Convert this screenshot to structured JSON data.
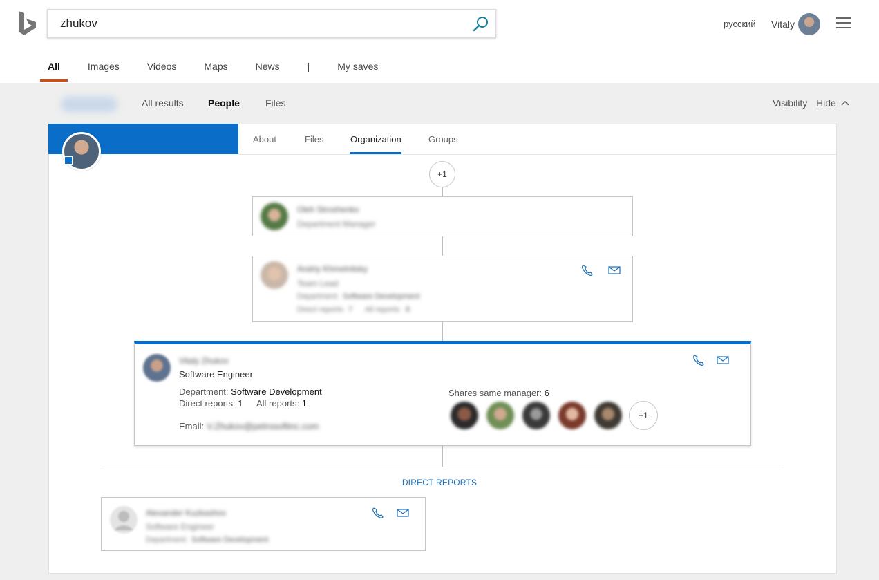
{
  "search": {
    "query": "zhukov"
  },
  "header": {
    "language": "русский",
    "user_name": "Vitaly"
  },
  "nav": {
    "items": [
      "All",
      "Images",
      "Videos",
      "Maps",
      "News",
      "|",
      "My saves"
    ],
    "active": "All"
  },
  "subnav": {
    "tabs": [
      "All results",
      "People",
      "Files"
    ],
    "active": "People",
    "visibility_label": "Visibility",
    "hide_label": "Hide"
  },
  "profile_tabs": {
    "items": [
      "About",
      "Files",
      "Organization",
      "Groups"
    ],
    "active": "Organization"
  },
  "org": {
    "more_managers_label": "+1",
    "manager2": {
      "name": "Oleh Stroshenko",
      "title": "Department Manager"
    },
    "manager1": {
      "name": "Andriy Khmelnitsky",
      "title": "Team Lead",
      "department_label": "Department:",
      "department": "Software Development",
      "direct_reports_label": "Direct reports:",
      "direct_reports": "7",
      "all_reports_label": "All reports:",
      "all_reports": "8"
    },
    "person": {
      "name": "Vitaly Zhukov",
      "title": "Software Engineer",
      "department_label": "Department:",
      "department": "Software Development",
      "direct_reports_label": "Direct reports:",
      "direct_reports": "1",
      "all_reports_label": "All reports:",
      "all_reports": "1",
      "email_label": "Email:",
      "email": "V.Zhukov@petrosoftinc.com",
      "shares_manager_label": "Shares same manager:",
      "shares_manager_count": "6",
      "more_peers_label": "+1"
    },
    "direct_reports_title": "DIRECT REPORTS",
    "report": {
      "name": "Alexander Kuzkashov",
      "title": "Software Engineer",
      "department_label": "Department:",
      "department": "Software Development"
    }
  },
  "colors": {
    "accent_blue": "#0a6ec8",
    "bing_active": "#d04a12",
    "link_blue": "#1a6fb8"
  },
  "icons": [
    "bing-logo-icon",
    "search-icon",
    "hamburger-menu-icon",
    "chevron-up-icon",
    "phone-icon",
    "mail-icon",
    "person-placeholder-icon"
  ]
}
